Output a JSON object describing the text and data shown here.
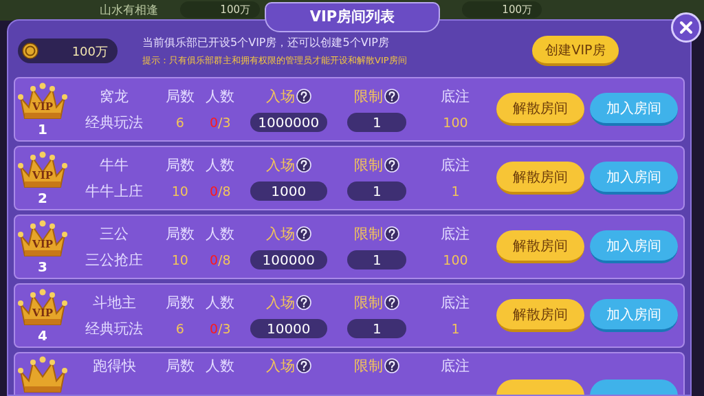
{
  "background": {
    "club_name": "山水有相逢",
    "coins": [
      "100万",
      "100万"
    ]
  },
  "title": "VIP房间列表",
  "balance": "100万",
  "info": "当前俱乐部已开设5个VIP房，还可以创建5个VIP房",
  "hint": "提示：只有俱乐部群主和拥有权限的管理员才能开设和解散VIP房间",
  "create_button": "创建VIP房",
  "rooms": [
    {
      "partial": false,
      "badge": "VIP",
      "number": "1",
      "game": "窝龙",
      "mode": "经典玩法",
      "labels": [
        "局数",
        "人数",
        "入场",
        "限制",
        "底注"
      ],
      "rounds": "6",
      "players_current": "0",
      "players_max": "/3",
      "entry": "1000000",
      "limit": "1",
      "base": "100",
      "buttons": [
        "解散房间",
        "加入房间"
      ]
    },
    {
      "partial": false,
      "badge": "VIP",
      "number": "2",
      "game": "牛牛",
      "mode": "牛牛上庄",
      "labels": [
        "局数",
        "人数",
        "入场",
        "限制",
        "底注"
      ],
      "rounds": "10",
      "players_current": "0",
      "players_max": "/8",
      "entry": "1000",
      "limit": "1",
      "base": "1",
      "buttons": [
        "解散房间",
        "加入房间"
      ]
    },
    {
      "partial": false,
      "badge": "VIP",
      "number": "3",
      "game": "三公",
      "mode": "三公抢庄",
      "labels": [
        "局数",
        "人数",
        "入场",
        "限制",
        "底注"
      ],
      "rounds": "10",
      "players_current": "0",
      "players_max": "/8",
      "entry": "100000",
      "limit": "1",
      "base": "100",
      "buttons": [
        "解散房间",
        "加入房间"
      ]
    },
    {
      "partial": false,
      "badge": "VIP",
      "number": "4",
      "game": "斗地主",
      "mode": "经典玩法",
      "labels": [
        "局数",
        "人数",
        "入场",
        "限制",
        "底注"
      ],
      "rounds": "6",
      "players_current": "0",
      "players_max": "/3",
      "entry": "10000",
      "limit": "1",
      "base": "1",
      "buttons": [
        "解散房间",
        "加入房间"
      ]
    },
    {
      "partial": true,
      "game": "跑得快",
      "labels": [
        "局数",
        "人数",
        "入场",
        "限制",
        "底注"
      ]
    }
  ]
}
